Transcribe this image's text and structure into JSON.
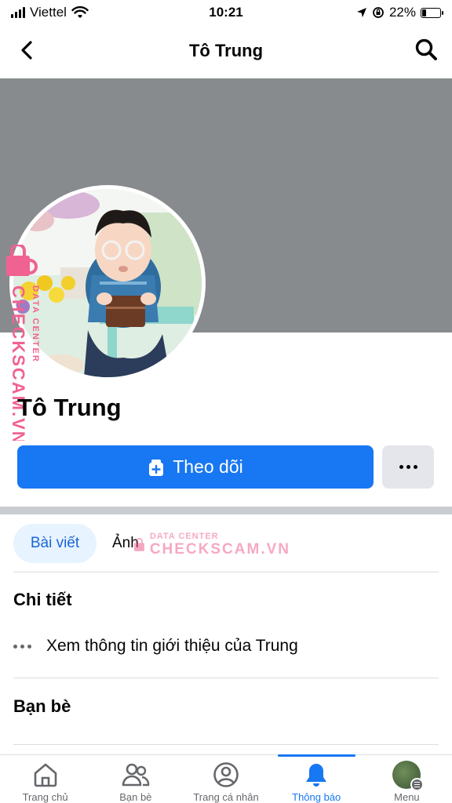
{
  "status_bar": {
    "carrier": "Viettel",
    "time": "10:21",
    "battery": "22%",
    "battery_level": 0.22
  },
  "nav": {
    "title": "Tô Trung",
    "back_icon": "chevron-left-icon",
    "search_icon": "search-icon"
  },
  "profile": {
    "name": "Tô Trung",
    "follow_label": "Theo dõi"
  },
  "tabs": {
    "posts": "Bài viết",
    "photos": "Ảnh"
  },
  "details": {
    "title": "Chi tiết",
    "about_text": "Xem thông tin giới thiệu của Trung"
  },
  "friends": {
    "title": "Bạn bè"
  },
  "tab_bar": {
    "items": [
      {
        "label": "Trang chủ",
        "icon": "home-icon"
      },
      {
        "label": "Bạn bè",
        "icon": "friends-icon"
      },
      {
        "label": "Trang cá nhân",
        "icon": "profile-icon"
      },
      {
        "label": "Thông báo",
        "icon": "bell-icon",
        "active": true
      },
      {
        "label": "Menu",
        "icon": "menu-avatar"
      }
    ]
  },
  "watermark": {
    "line1": "DATA CENTER",
    "line2": "CHECKSCAM.VN"
  },
  "colors": {
    "accent": "#1877f2",
    "cover": "#878b8e",
    "watermark": "#f06292"
  }
}
